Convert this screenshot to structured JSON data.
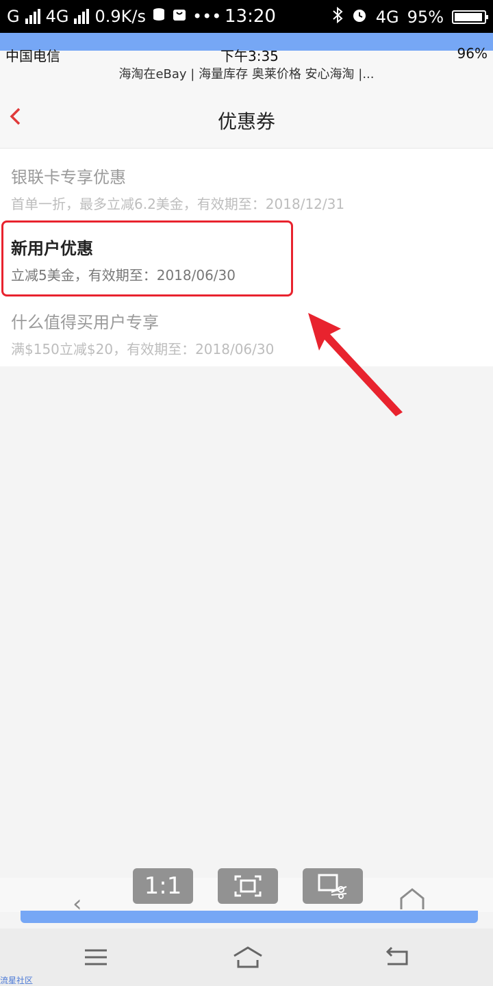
{
  "os_status": {
    "network": "G",
    "network2": "4G",
    "speed": "0.9K/s",
    "dots": "•••",
    "time": "13:20",
    "network3": "4G",
    "battery": "95%"
  },
  "inner_status": {
    "carrier": "中国电信",
    "time": "下午3:35",
    "battery": "96%",
    "subtitle": "海淘在eBay | 海量库存 奥莱价格 安心海淘 |..."
  },
  "header": {
    "title": "优惠券"
  },
  "coupons": [
    {
      "name": "银联卡专享优惠",
      "desc": "首单一折，最多立减6.2美金，有效期至：2018/12/31"
    },
    {
      "name": "新用户优惠",
      "desc": "立减5美金，有效期至：2018/06/30"
    },
    {
      "name": "什么值得买用户专享",
      "desc": "满$150立减$20，有效期至：2018/06/30"
    }
  ],
  "toolbar": {
    "ratio_label": "1:1"
  },
  "watermark": "流星社区",
  "colors": {
    "accent": "#e8232e",
    "strip": "#76a7f5"
  }
}
